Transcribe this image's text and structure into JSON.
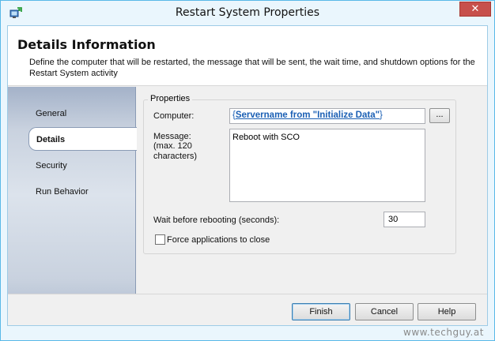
{
  "window": {
    "title": "Restart System Properties",
    "close_symbol": "✕",
    "app_icon": "restart-system-icon"
  },
  "header": {
    "title": "Details Information",
    "description": "Define the computer that will be restarted, the message that will be sent, the wait time, and shutdown options for the Restart System activity"
  },
  "sidebar": {
    "items": [
      {
        "label": "General",
        "selected": false
      },
      {
        "label": "Details",
        "selected": true
      },
      {
        "label": "Security",
        "selected": false
      },
      {
        "label": "Run Behavior",
        "selected": false
      }
    ]
  },
  "properties": {
    "group_label": "Properties",
    "computer_label": "Computer:",
    "computer_value_open": "{",
    "computer_value_link": "Servername from \"Initialize Data\"",
    "computer_value_close": "}",
    "browse_label": "...",
    "message_label": "Message:",
    "message_hint": "(max. 120 characters)",
    "message_value": "Reboot with SCO",
    "wait_label": "Wait before rebooting (seconds):",
    "wait_value": "30",
    "force_close_label": "Force applications to close",
    "force_close_checked": false
  },
  "footer": {
    "finish_label": "Finish",
    "cancel_label": "Cancel",
    "help_label": "Help"
  },
  "watermark": "www.techguy.at",
  "colors": {
    "close_button": "#c7504b",
    "link": "#1a5fb4",
    "window_border": "#59b9e8"
  }
}
